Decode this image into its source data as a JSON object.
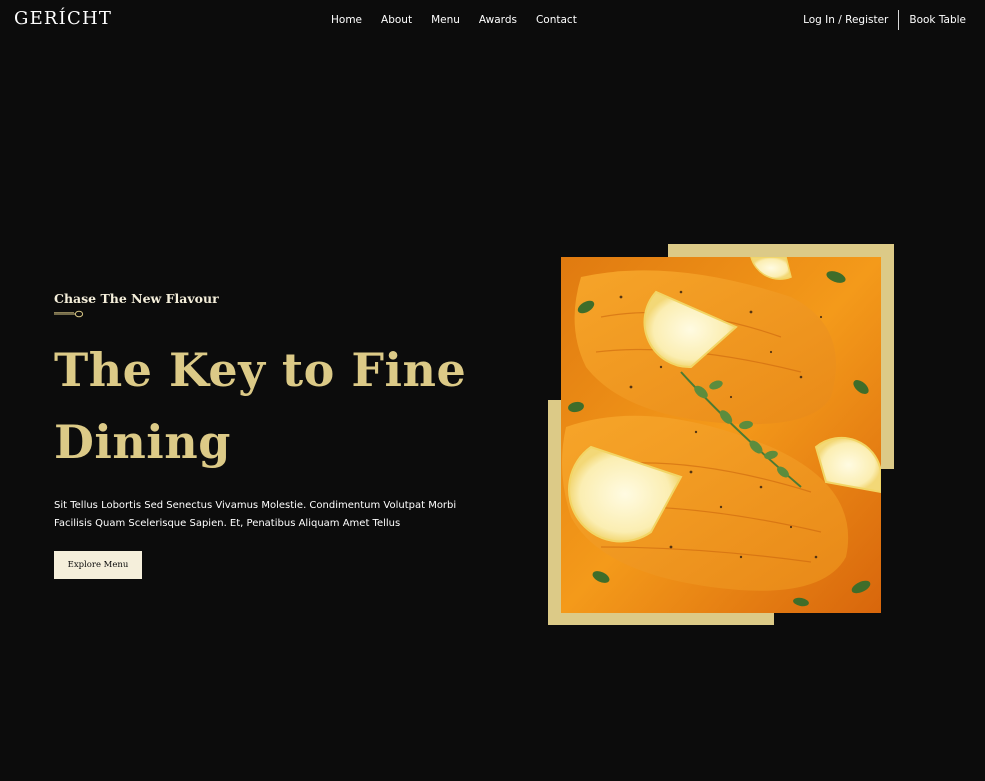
{
  "brand": {
    "logo_text": "GERÍCHT"
  },
  "nav": {
    "links": [
      {
        "label": "Home"
      },
      {
        "label": "About"
      },
      {
        "label": "Menu"
      },
      {
        "label": "Awards"
      },
      {
        "label": "Contact"
      }
    ],
    "login_label": "Log In / Register",
    "book_label": "Book Table"
  },
  "hero": {
    "subtitle": "Chase The New Flavour",
    "headline": "The Key to Fine Dining",
    "description": "Sit Tellus Lobortis Sed Senectus Vivamus Molestie. Condimentum Volutpat Morbi Facilisis Quam Scelerisque Sapien. Et, Penatibus Aliquam Amet Tellus",
    "button_label": "Explore Menu",
    "divider_icon": "spoon-icon",
    "image_subject": "salmon-dish-image"
  },
  "colors": {
    "background": "#0c0c0c",
    "gold": "#dcca87",
    "cream": "#f5efdb",
    "white": "#ffffff"
  }
}
